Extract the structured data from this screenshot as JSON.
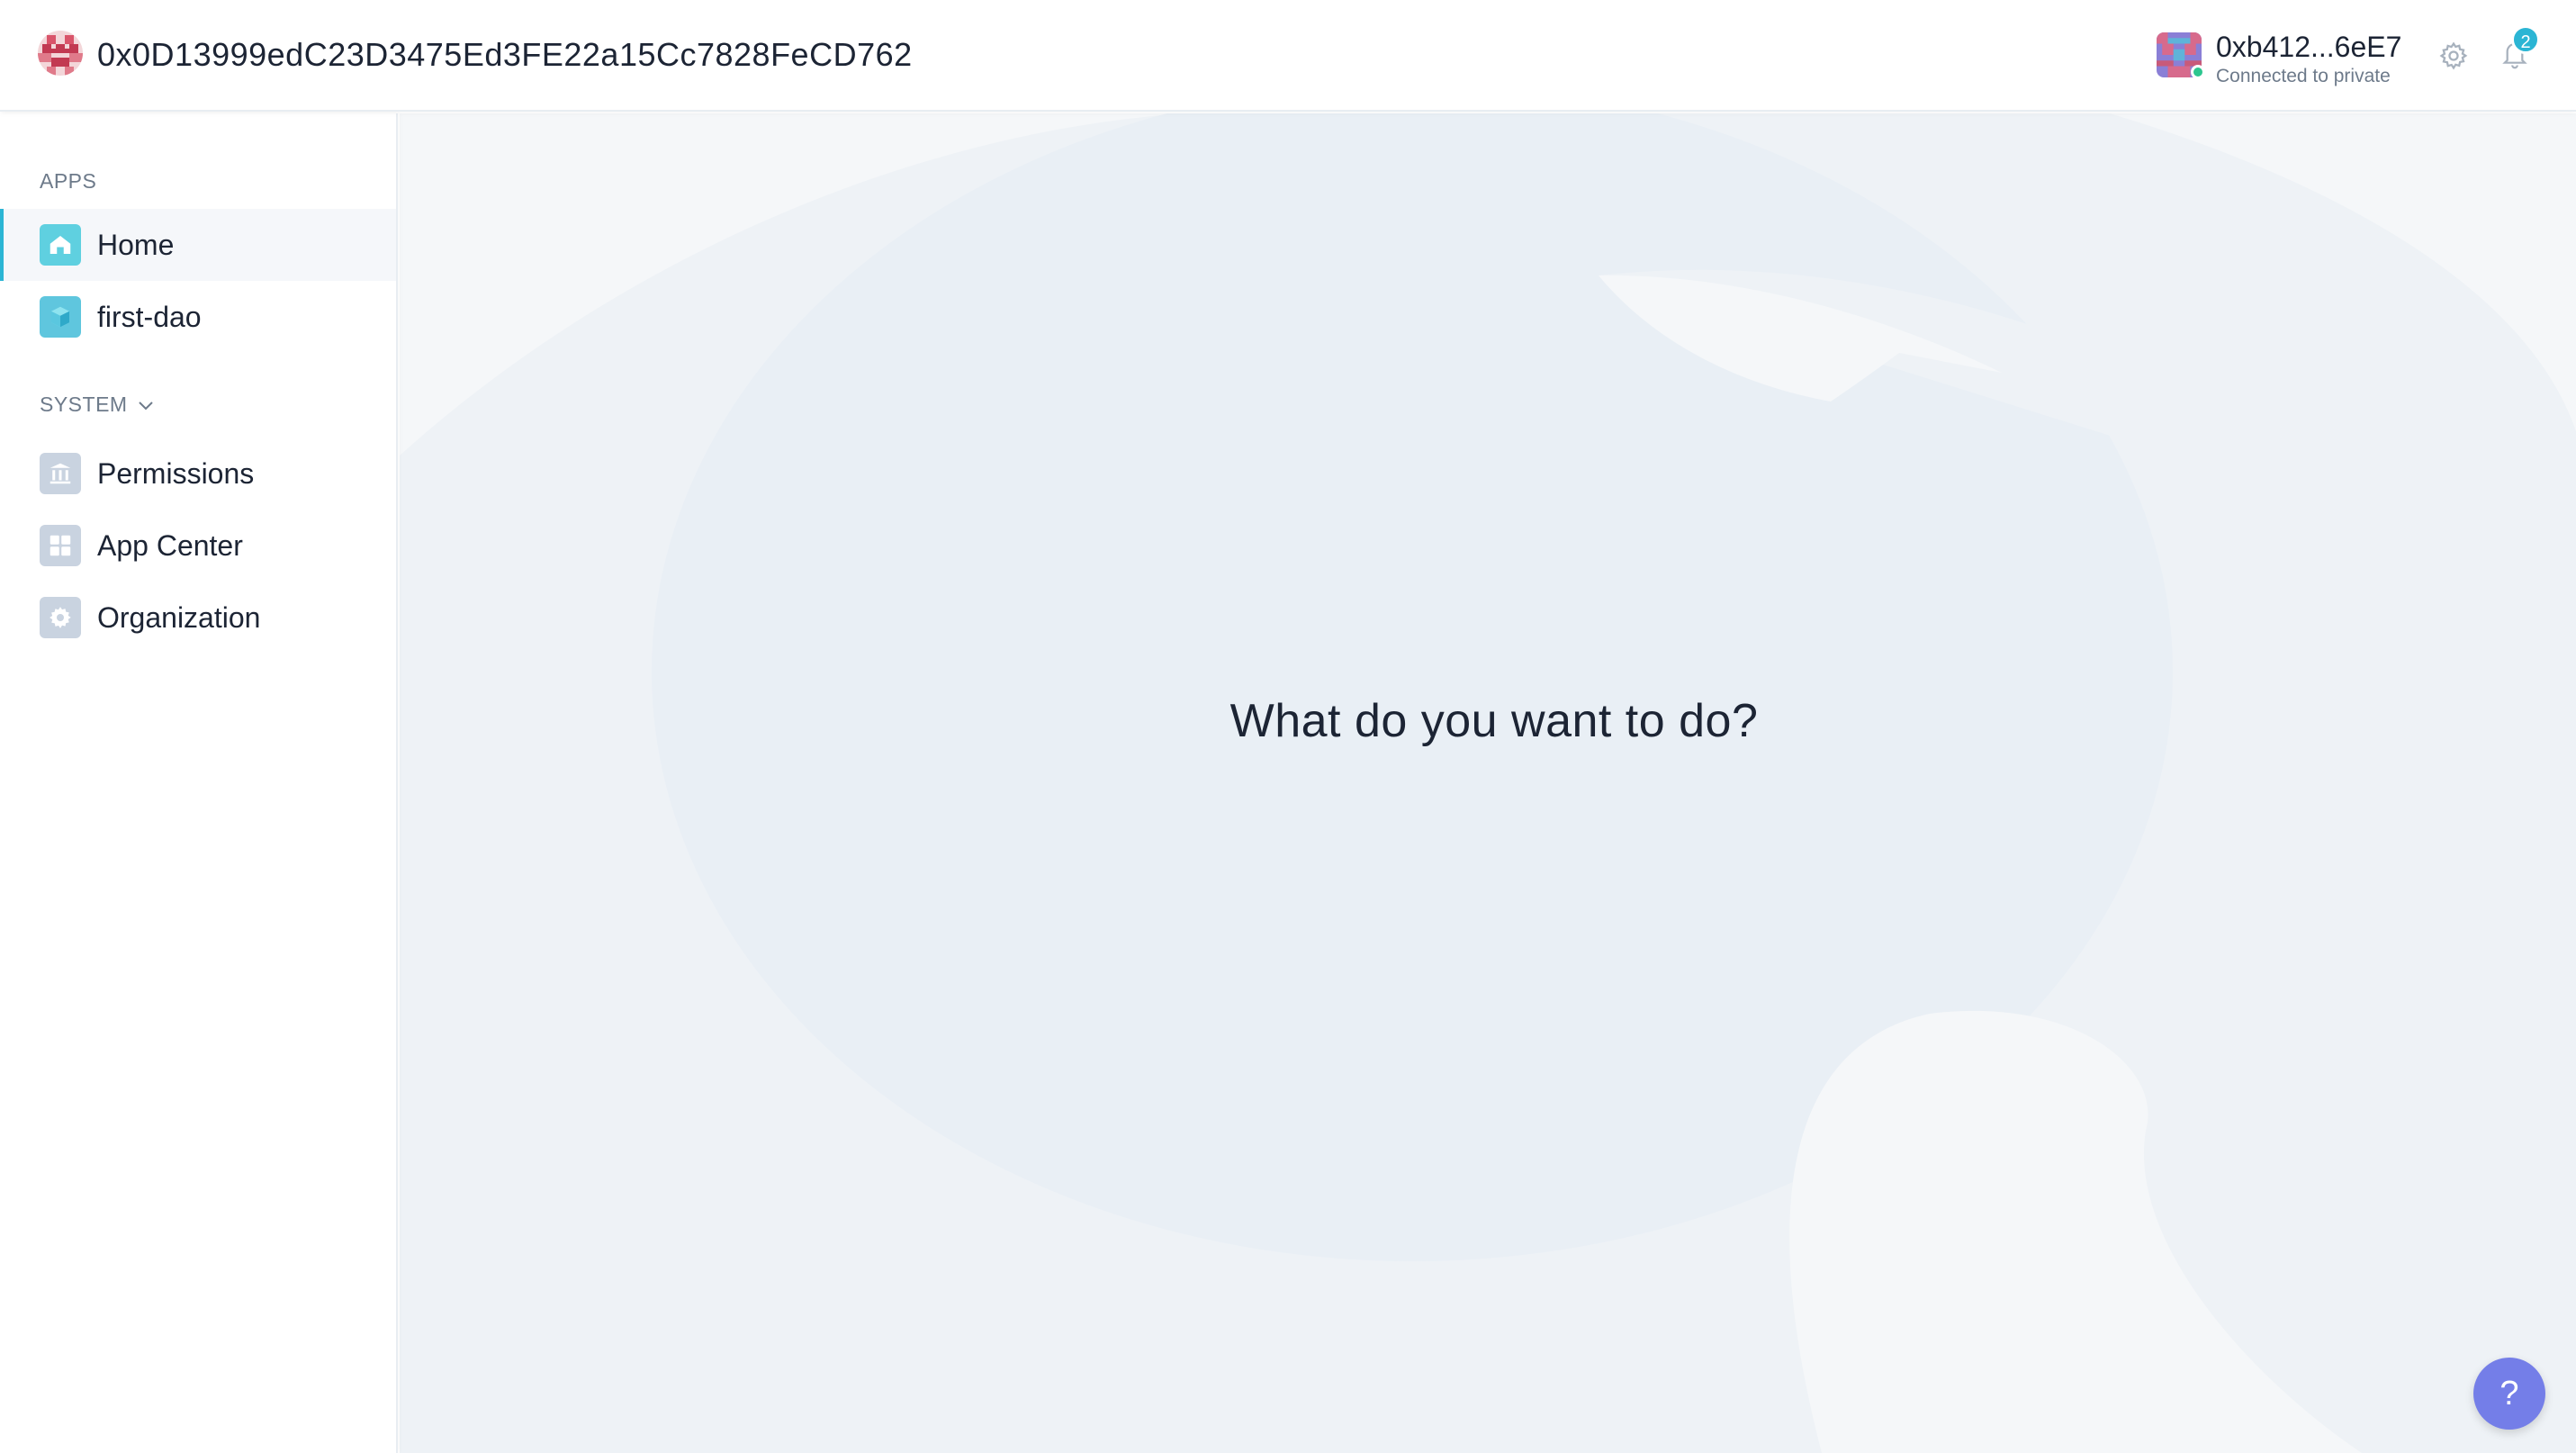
{
  "header": {
    "org_address": "0x0D13999edC23D3475Ed3FE22a15Cc7828FeCD762",
    "account": {
      "address": "0xb412...6eE7",
      "status": "Connected to private"
    },
    "notifications_count": "2",
    "icons": {
      "org": "org-identicon",
      "account": "account-identicon",
      "settings": "gear-icon",
      "notifications": "bell-icon"
    }
  },
  "sidebar": {
    "apps_label": "APPS",
    "apps": [
      {
        "label": "Home",
        "icon": "home-icon",
        "active": true
      },
      {
        "label": "first-dao",
        "icon": "app-cube-icon",
        "active": false
      }
    ],
    "system_label": "SYSTEM",
    "system": [
      {
        "label": "Permissions",
        "icon": "bank-icon"
      },
      {
        "label": "App Center",
        "icon": "grid-icon"
      },
      {
        "label": "Organization",
        "icon": "gear-icon"
      }
    ]
  },
  "main": {
    "prompt": "What do you want to do?"
  },
  "help": {
    "label": "?"
  },
  "colors": {
    "accent": "#2bb5d4",
    "help_button": "#747ee8",
    "connected_dot": "#2cc68f",
    "background": "#f5f7f9"
  }
}
